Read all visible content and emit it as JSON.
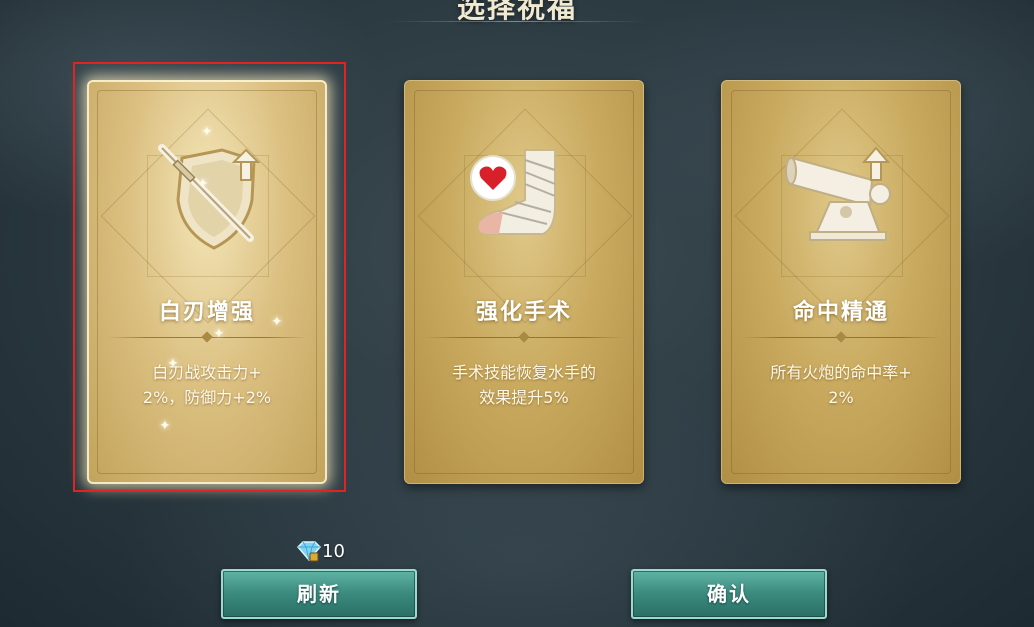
{
  "screen": {
    "title": "选择祝福"
  },
  "cards": [
    {
      "title": "白刃增强",
      "desc_line1": "白刃战攻击力+",
      "desc_line2": "2%，防御力+2%",
      "icon": "sword-shield-up-icon",
      "selected": true
    },
    {
      "title": "强化手术",
      "desc_line1": "手术技能恢复水手的",
      "desc_line2": "效果提升5%",
      "icon": "bandaged-foot-heart-icon",
      "selected": false
    },
    {
      "title": "命中精通",
      "desc_line1": "所有火炮的命中率+",
      "desc_line2": "2%",
      "icon": "cannon-up-icon",
      "selected": false
    }
  ],
  "refresh_cost": {
    "amount": "10",
    "icon": "diamond-gem-icon"
  },
  "buttons": {
    "refresh": "刷新",
    "confirm": "确认"
  },
  "colors": {
    "card_gold": "#c9aa5f",
    "button_teal": "#3a8a7e",
    "selection_red": "#e02424"
  }
}
